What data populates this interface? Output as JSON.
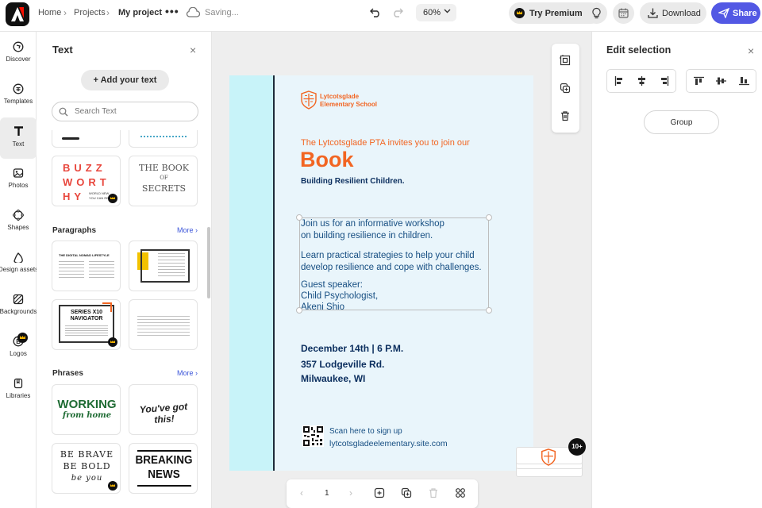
{
  "topbar": {
    "breadcrumbs": [
      "Home",
      "Projects",
      "My project"
    ],
    "separator": "›",
    "more": "•••",
    "status": "Saving...",
    "zoom": "60%",
    "premium_label": "Try Premium",
    "download_label": "Download",
    "share_label": "Share"
  },
  "rail": {
    "items": [
      {
        "label": "Discover"
      },
      {
        "label": "Templates"
      },
      {
        "label": "Text"
      },
      {
        "label": "Photos"
      },
      {
        "label": "Shapes"
      },
      {
        "label": "Design assets"
      },
      {
        "label": "Backgrounds"
      },
      {
        "label": "Logos"
      },
      {
        "label": "Libraries"
      }
    ],
    "active": "Text"
  },
  "panel": {
    "title": "Text",
    "close": "×",
    "add_text": "Add your text",
    "search_placeholder": "Search Text",
    "buzz": [
      "BUZZ",
      "WORT",
      "HY"
    ],
    "buzz_small": [
      "WORLD NEW",
      "YOU CAN RE"
    ],
    "book_secrets": [
      "THE BOOK",
      "OF",
      "SECRETS"
    ],
    "sections": [
      {
        "title": "Paragraphs",
        "more": "More ›"
      },
      {
        "title": "Phrases",
        "more": "More ›"
      }
    ],
    "paragraph_thumbs": {
      "p1_title": "THE DIGITAL NOMAD LIFESTYLE",
      "p3_title": [
        "SERIES X10",
        "NAVIGATOR"
      ]
    },
    "phrases": {
      "working": "WORKING",
      "from_home": "from home",
      "youve": "You've got this!",
      "brave1": "BE BRAVE",
      "brave2": "BE BOLD",
      "brave3": "be you",
      "breaking1": "BREAKING",
      "breaking2": "NEWS"
    }
  },
  "canvas": {
    "school_name": [
      "Lytcotsglade",
      "Elementary School"
    ],
    "invite": "The Lytcotsglade PTA invites you to join our",
    "title": "Book",
    "subtitle": "Building Resilient Children.",
    "body1": [
      "Join us for an informative workshop",
      "on building resilience in children."
    ],
    "body2": [
      "Learn practical strategies to help your child",
      "develop resilience and cope with challenges."
    ],
    "body3": [
      "Guest speaker:",
      "Child Psychologist,",
      "Akeni Shio"
    ],
    "date": "December 14th | 6 P.M.",
    "address1": "357 Lodgeville Rd.",
    "address2": "Milwaukee, WI",
    "scan1": "Scan here to sign up",
    "scan2": "lytcotsgladeelementary.site.com",
    "page_number": "1",
    "page_count": "10+",
    "colors": {
      "accent": "#f26522",
      "navy": "#0b2e5e",
      "band": "#c8f3f9",
      "bg": "#e9f5fb",
      "share": "#5258e4"
    }
  },
  "rpanel": {
    "title": "Edit selection",
    "close": "×",
    "group_label": "Group"
  }
}
